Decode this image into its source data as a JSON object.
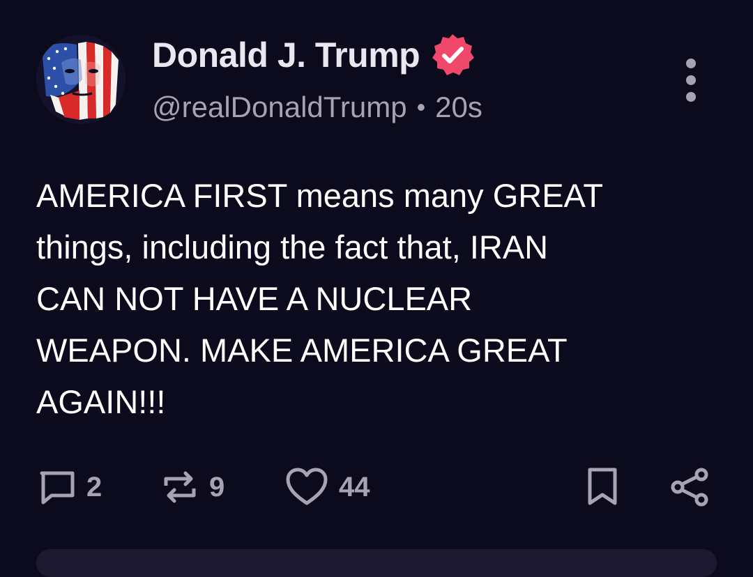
{
  "author": {
    "display_name": "Donald J. Trump",
    "handle": "@realDonaldTrump",
    "separator": "•",
    "timestamp": "20s",
    "verified_icon": "verified-badge-icon",
    "verified_color": "#f0486a"
  },
  "post": {
    "text": "AMERICA FIRST means many GREAT\nthings, including the fact that, IRAN\nCAN NOT HAVE A NUCLEAR\nWEAPON. MAKE AMERICA GREAT\nAGAIN!!!"
  },
  "actions": {
    "replies": "2",
    "reposts": "9",
    "likes": "44"
  },
  "icons": {
    "more": "more-vertical-icon",
    "reply": "reply-icon",
    "repost": "repost-icon",
    "like": "heart-icon",
    "bookmark": "bookmark-icon",
    "share": "share-icon"
  },
  "colors": {
    "background": "#0c0a1d",
    "text": "#ffffff",
    "muted": "#a6a3b4"
  }
}
